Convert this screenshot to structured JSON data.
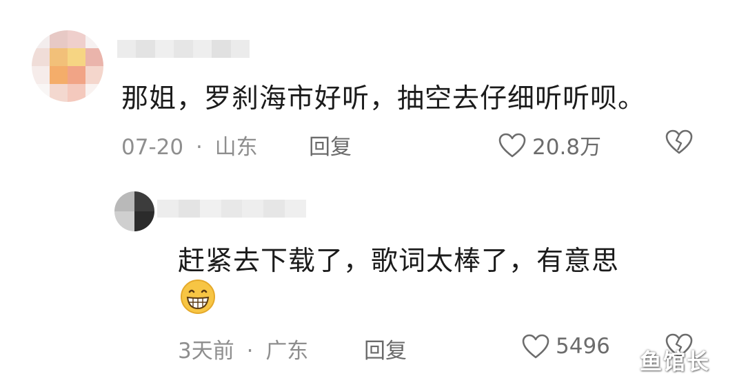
{
  "comments": [
    {
      "avatar_colors": [
        "#f3eded",
        "#e7c9c5",
        "#efcfcc",
        "#f6f1f1",
        "#f0ddd8",
        "#f2c079",
        "#f6d583",
        "#eab4ab",
        "#f6ecea",
        "#f4ad6a",
        "#f1a486",
        "#f4d6cc",
        "#f9f6f5",
        "#f3d8cf",
        "#f4c9bd",
        "#f9f2f0"
      ],
      "name_colors": [
        "#ececec",
        "#e3e3e3",
        "#efefef",
        "#e6e6e6",
        "#eeeeee",
        "#e1e1e1",
        "#ebebeb"
      ],
      "text": "那姐，罗刹海市好听，抽空去仔细听听呗。",
      "date": "07-20",
      "separator": "·",
      "location": "山东",
      "reply_label": "回复",
      "likes": "20.8万",
      "icons": [
        "heart-outline-icon",
        "broken-heart-icon"
      ]
    },
    {
      "avatar_colors": [
        "#b9b9b9",
        "#3c3c3c",
        "#cfcfcf",
        "#2b2b2b"
      ],
      "name_colors": [
        "#ededed",
        "#e4e4e4",
        "#f0f0f0",
        "#e8e8e8",
        "#eeeeee",
        "#e6e6e6",
        "#efefef"
      ],
      "text": "赶紧去下载了，歌词太棒了，有意思",
      "emoji": "grinning-face-icon",
      "date": "3天前",
      "separator": "·",
      "location": "广东",
      "reply_label": "回复",
      "likes": "5496",
      "icons": [
        "heart-outline-icon",
        "broken-heart-icon"
      ]
    }
  ],
  "watermark": "鱼馆长",
  "colors": {
    "text": "#1b1b1b",
    "meta": "#8e8e8e",
    "icon": "#6c6c6c",
    "emoji": "#f7c544"
  }
}
